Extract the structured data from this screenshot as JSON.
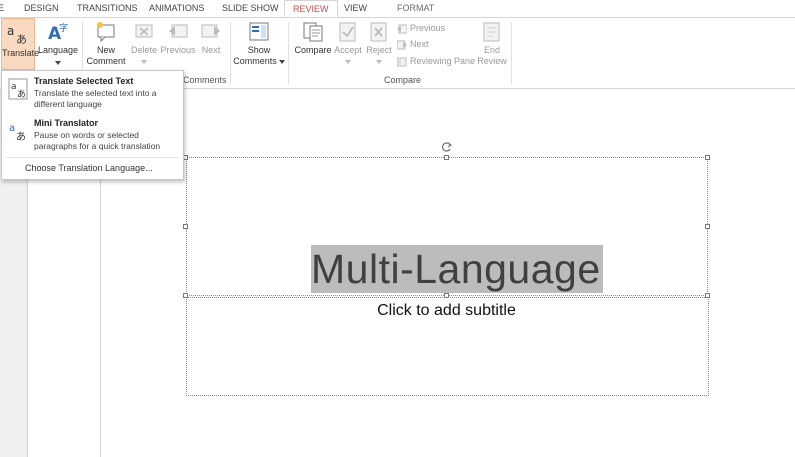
{
  "tabs": {
    "partial": "E",
    "design": "DESIGN",
    "transitions": "TRANSITIONS",
    "animations": "ANIMATIONS",
    "slide_show": "SLIDE SHOW",
    "review": "REVIEW",
    "view": "VIEW",
    "format": "FORMAT"
  },
  "ribbon": {
    "translate": "Translate",
    "language": "Language",
    "new_comment": "New Comment",
    "new_comment_l1": "New",
    "new_comment_l2": "Comment",
    "delete": "Delete",
    "previous": "Previous",
    "next": "Next",
    "show_comments_l1": "Show",
    "show_comments_l2": "Comments",
    "compare": "Compare",
    "accept": "Accept",
    "reject": "Reject",
    "compare_previous": "Previous",
    "compare_next": "Next",
    "reviewing_pane": "Reviewing Pane",
    "end_review_l1": "End",
    "end_review_l2": "Review",
    "group_comments": "Comments",
    "group_compare": "Compare"
  },
  "translate_menu": {
    "item1_title": "Translate Selected Text",
    "item1_desc": "Translate the selected text into a different language",
    "item2_title": "Mini Translator",
    "item2_desc": "Pause on words or selected paragraphs for a quick translation",
    "choose_language": "Choose Translation Language..."
  },
  "slide": {
    "title": "Multi-Language",
    "subtitle_placeholder": "Click to add subtitle"
  },
  "colors": {
    "accent": "#c0504d",
    "translate_highlight": "#f9d9c0",
    "selection": "#bcbcbc"
  }
}
